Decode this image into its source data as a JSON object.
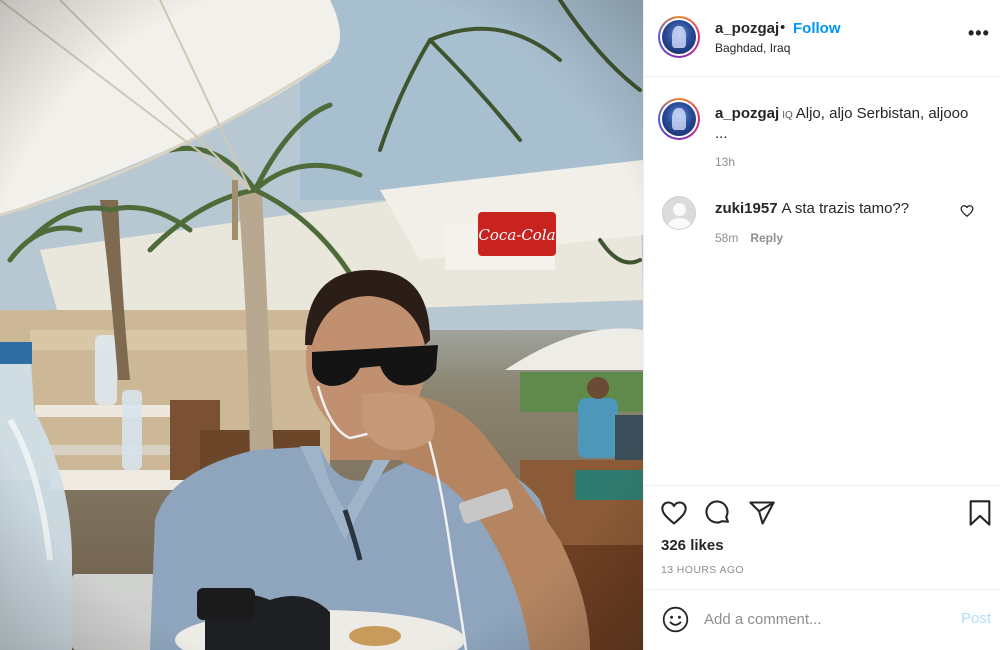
{
  "post": {
    "username": "a_pozgaj",
    "separator": "•",
    "follow_label": "Follow",
    "location": "Baghdad, Iraq",
    "more_icon": "more-options-icon",
    "more_label": "•••"
  },
  "caption": {
    "username": "a_pozgaj",
    "flag": "IQ",
    "text": "Aljo, aljo Serbistan, aljooo",
    "ellipsis": "...",
    "time": "13h"
  },
  "comments": [
    {
      "username": "zuki1957",
      "text": "A sta trazis tamo??",
      "time": "58m",
      "reply_label": "Reply"
    }
  ],
  "actions": {
    "icons": [
      "heart-icon",
      "comment-icon",
      "share-icon",
      "bookmark-icon"
    ],
    "likes": "326 likes",
    "posted_ago": "13 HOURS AGO"
  },
  "add_comment": {
    "placeholder": "Add a comment...",
    "post_label": "Post",
    "post_color_disabled": "#b2dffc"
  },
  "colors": {
    "link_blue": "#0095f6",
    "secondary_text": "#8e8e8e",
    "primary_text": "#262626",
    "border": "#efefef"
  }
}
